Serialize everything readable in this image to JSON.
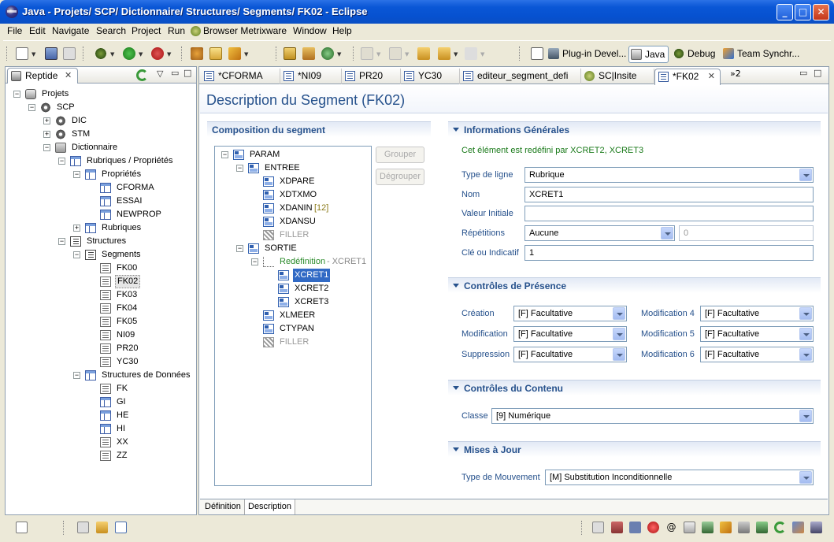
{
  "window": {
    "title": "Java - Projets/ SCP/ Dictionnaire/ Structures/ Segments/ FK02 - Eclipse",
    "minimize": "_",
    "maximize": "□",
    "close": "✕"
  },
  "menu": [
    "File",
    "Edit",
    "Navigate",
    "Search",
    "Project",
    "Run",
    "Browser Metrixware",
    "Window",
    "Help"
  ],
  "perspectives": {
    "plugin": "Plug-in Devel...",
    "java": "Java",
    "debug": "Debug",
    "team": "Team Synchr..."
  },
  "left_view": {
    "tab_label": "Reptide",
    "tree": [
      {
        "label": "Projets",
        "depth": 0,
        "icon": "db",
        "toggle": "-"
      },
      {
        "label": "SCP",
        "depth": 1,
        "icon": "gear",
        "toggle": "-"
      },
      {
        "label": "DIC",
        "depth": 2,
        "icon": "gear",
        "toggle": "+"
      },
      {
        "label": "STM",
        "depth": 2,
        "icon": "gear",
        "toggle": "+"
      },
      {
        "label": "Dictionnaire",
        "depth": 2,
        "icon": "folder",
        "toggle": "-"
      },
      {
        "label": "Rubriques / Propriétés",
        "depth": 3,
        "icon": "table",
        "toggle": "-"
      },
      {
        "label": "Propriétés",
        "depth": 4,
        "icon": "table",
        "toggle": "-"
      },
      {
        "label": "CFORMA",
        "depth": 5,
        "icon": "table",
        "toggle": ""
      },
      {
        "label": "ESSAI",
        "depth": 5,
        "icon": "table",
        "toggle": ""
      },
      {
        "label": "NEWPROP",
        "depth": 5,
        "icon": "table",
        "toggle": ""
      },
      {
        "label": "Rubriques",
        "depth": 4,
        "icon": "table",
        "toggle": "+"
      },
      {
        "label": "Structures",
        "depth": 3,
        "icon": "struct",
        "toggle": "-"
      },
      {
        "label": "Segments",
        "depth": 4,
        "icon": "struct",
        "toggle": "-"
      },
      {
        "label": "FK00",
        "depth": 5,
        "icon": "seg",
        "toggle": ""
      },
      {
        "label": "FK02",
        "depth": 5,
        "icon": "seg",
        "toggle": "",
        "selected": true
      },
      {
        "label": "FK03",
        "depth": 5,
        "icon": "seg",
        "toggle": ""
      },
      {
        "label": "FK04",
        "depth": 5,
        "icon": "seg",
        "toggle": ""
      },
      {
        "label": "FK05",
        "depth": 5,
        "icon": "seg",
        "toggle": ""
      },
      {
        "label": "NI09",
        "depth": 5,
        "icon": "seg",
        "toggle": ""
      },
      {
        "label": "PR20",
        "depth": 5,
        "icon": "seg",
        "toggle": ""
      },
      {
        "label": "YC30",
        "depth": 5,
        "icon": "seg",
        "toggle": ""
      },
      {
        "label": "Structures de Données",
        "depth": 4,
        "icon": "table",
        "toggle": "-"
      },
      {
        "label": "FK",
        "depth": 5,
        "icon": "seg",
        "toggle": ""
      },
      {
        "label": "GI",
        "depth": 5,
        "icon": "table",
        "toggle": ""
      },
      {
        "label": "HE",
        "depth": 5,
        "icon": "table",
        "toggle": ""
      },
      {
        "label": "HI",
        "depth": 5,
        "icon": "table",
        "toggle": ""
      },
      {
        "label": "XX",
        "depth": 5,
        "icon": "seg",
        "toggle": ""
      },
      {
        "label": "ZZ",
        "depth": 5,
        "icon": "seg",
        "toggle": ""
      }
    ]
  },
  "editor": {
    "tabs": [
      {
        "label": "*CFORMA",
        "active": false
      },
      {
        "label": "*NI09",
        "active": false
      },
      {
        "label": "PR20",
        "active": false
      },
      {
        "label": "YC30",
        "active": false
      },
      {
        "label": "editeur_segment_defi",
        "active": false
      },
      {
        "label": "SC|Insite",
        "active": false
      },
      {
        "label": "*FK02",
        "active": true
      }
    ],
    "overflow_label": "»2",
    "form_title": "Description du Segment  (FK02)",
    "composition": {
      "title": "Composition du segment",
      "grouper": "Grouper",
      "degrouper": "Dégrouper",
      "tree": [
        {
          "label": "PARAM",
          "depth": 0,
          "toggle": "-",
          "icon": "fld"
        },
        {
          "label": "ENTREE",
          "depth": 1,
          "toggle": "-",
          "icon": "fld"
        },
        {
          "label": "XDPARE",
          "depth": 2,
          "toggle": "",
          "icon": "fld"
        },
        {
          "label": "XDTXMO",
          "depth": 2,
          "toggle": "",
          "icon": "fld"
        },
        {
          "label": "XDANIN",
          "depth": 2,
          "toggle": "",
          "icon": "fld",
          "suffix": " [12]"
        },
        {
          "label": "XDANSU",
          "depth": 2,
          "toggle": "",
          "icon": "fld"
        },
        {
          "label": "FILLER",
          "depth": 2,
          "toggle": "",
          "icon": "filler",
          "muted": true
        },
        {
          "label": "SORTIE",
          "depth": 1,
          "toggle": "-",
          "icon": "fld"
        },
        {
          "label": "Redéfinition",
          "depth": 2,
          "toggle": "-",
          "icon": "redef",
          "suffix": " - XCRET1",
          "redef": true
        },
        {
          "label": "XCRET1",
          "depth": 3,
          "toggle": "",
          "icon": "fld",
          "selected": true
        },
        {
          "label": "XCRET2",
          "depth": 3,
          "toggle": "",
          "icon": "fld"
        },
        {
          "label": "XCRET3",
          "depth": 3,
          "toggle": "",
          "icon": "fld"
        },
        {
          "label": "XLMEER",
          "depth": 2,
          "toggle": "",
          "icon": "fld"
        },
        {
          "label": "CTYPAN",
          "depth": 2,
          "toggle": "",
          "icon": "fld"
        },
        {
          "label": "FILLER",
          "depth": 2,
          "toggle": "",
          "icon": "filler",
          "muted": true
        }
      ]
    },
    "infos": {
      "title": "Informations Générales",
      "note": "Cet élément est redéfini par XCRET2, XCRET3",
      "type_ligne_label": "Type de ligne",
      "type_ligne_value": "Rubrique",
      "nom_label": "Nom",
      "nom_value": "XCRET1",
      "valeur_label": "Valeur Initiale",
      "valeur_value": "",
      "repetitions_label": "Répétitions",
      "repetitions_value": "Aucune",
      "repetitions_count": "0",
      "cle_label": "Clé ou Indicatif",
      "cle_value": "1"
    },
    "presence": {
      "title": "Contrôles de Présence",
      "creation_label": "Création",
      "creation_value": "[F]  Facultative",
      "modification_label": "Modification",
      "modification_value": "[F]  Facultative",
      "suppression_label": "Suppression",
      "suppression_value": "[F]  Facultative",
      "mod4_label": "Modification 4",
      "mod4_value": "[F]  Facultative",
      "mod5_label": "Modification 5",
      "mod5_value": "[F]  Facultative",
      "mod6_label": "Modification 6",
      "mod6_value": "[F]  Facultative"
    },
    "contenu": {
      "title": "Contrôles du Contenu",
      "classe_label": "Classe",
      "classe_value": "[9]  Numérique"
    },
    "maj": {
      "title": "Mises à Jour",
      "type_mvt_label": "Type de Mouvement",
      "type_mvt_value": "[M]  Substitution Inconditionnelle"
    },
    "bottom_tabs": [
      "Définition",
      "Description"
    ]
  },
  "colors": {
    "section_title": "#26518c",
    "note_green": "#1a7a1a",
    "redef_green": "#2a8a2a",
    "selection": "#316ac5"
  }
}
